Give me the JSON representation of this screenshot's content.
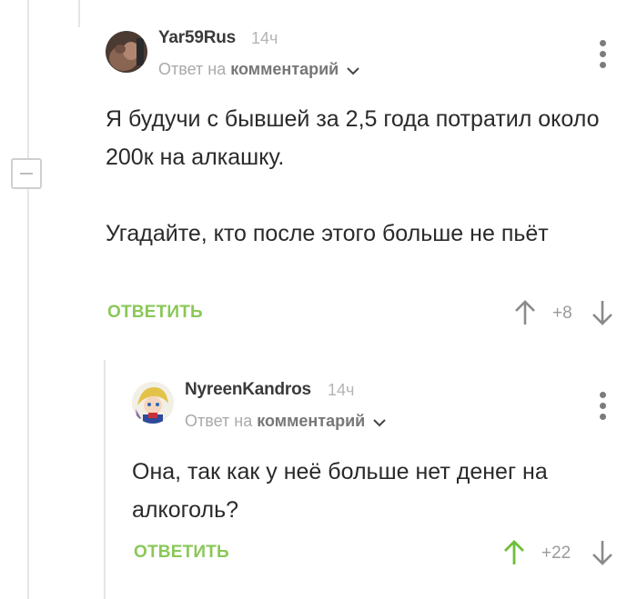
{
  "ui": {
    "colors": {
      "accent_green": "#8ac858",
      "upvoted_green": "#6dbf3a",
      "muted": "#9a9a9a"
    }
  },
  "comments": [
    {
      "author": "Yar59Rus",
      "time": "14ч",
      "reply_prefix": "Ответ на",
      "reply_target": "комментарий",
      "body": [
        "Я будучи с бывшей за 2,5 года потратил около 200к на алкашку.",
        "Угадайте, кто после этого больше не пьёт"
      ],
      "reply_label": "ОТВЕТИТЬ",
      "score": "+8",
      "upvoted": false
    },
    {
      "author": "NyreenKandros",
      "time": "14ч",
      "reply_prefix": "Ответ на",
      "reply_target": "комментарий",
      "body": [
        "Она, так как у неё больше нет денег на алкоголь?"
      ],
      "reply_label": "ОТВЕТИТЬ",
      "score": "+22",
      "upvoted": true
    }
  ]
}
